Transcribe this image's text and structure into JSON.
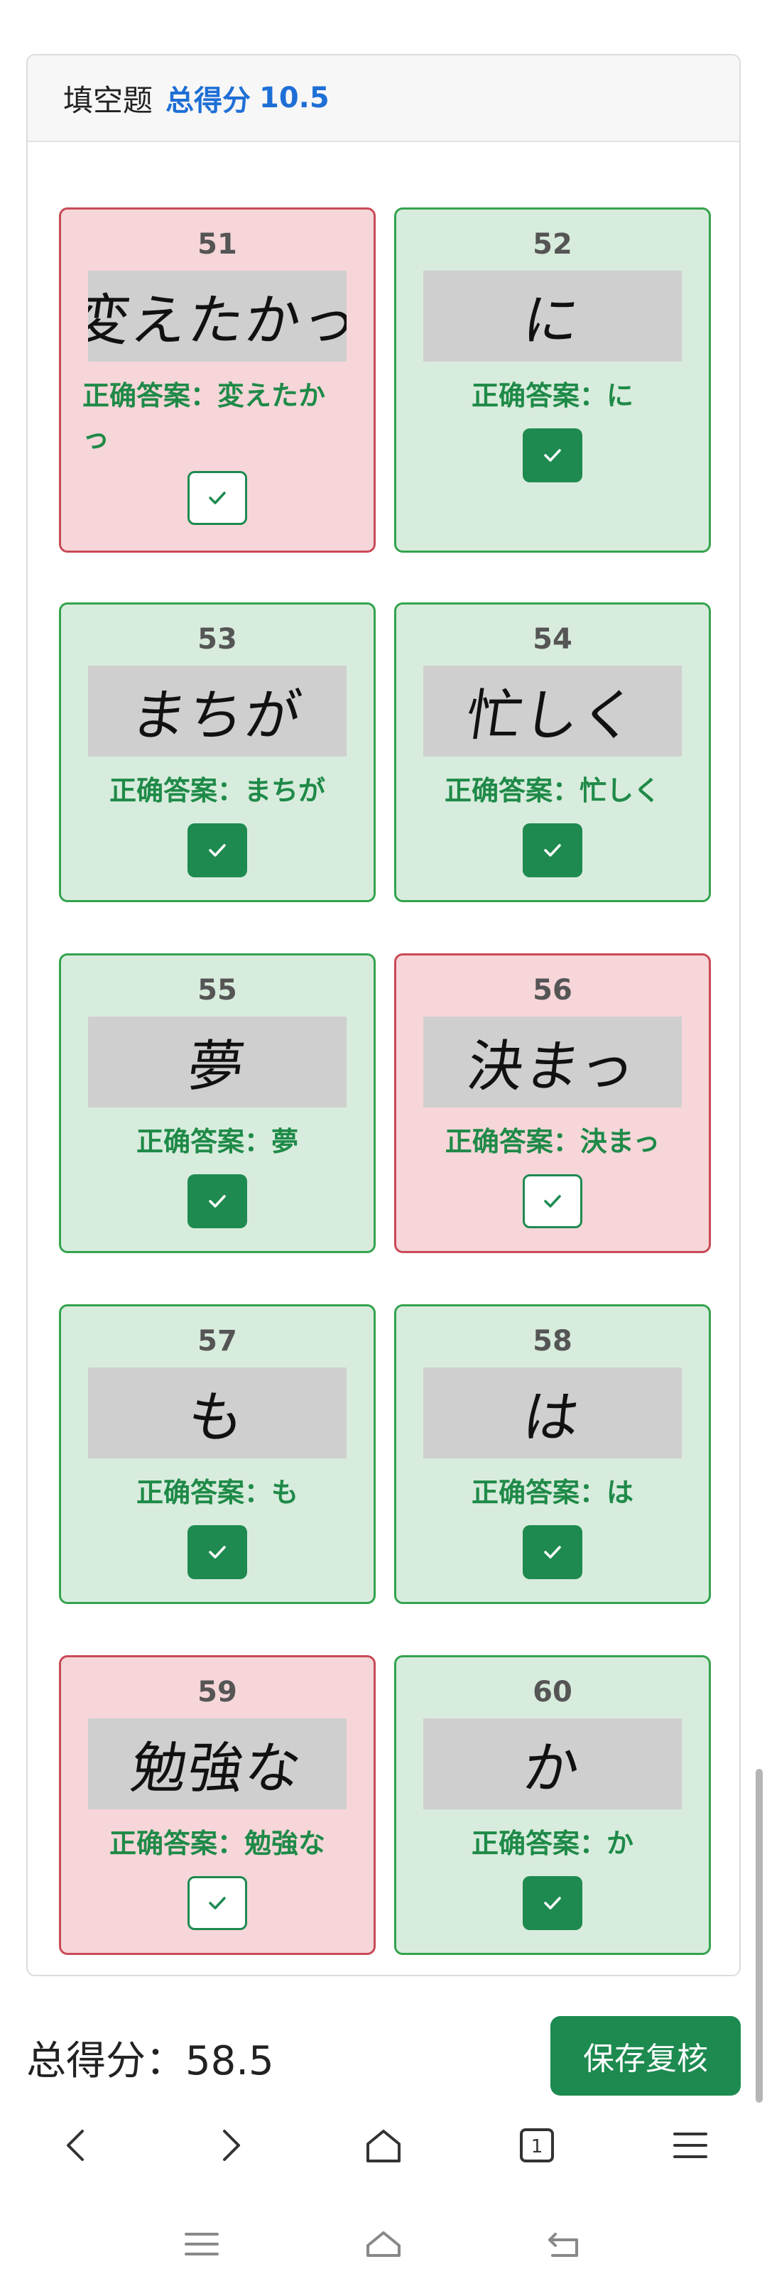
{
  "section": {
    "title": "填空题",
    "score_label": "总得分",
    "score_value": "10.5"
  },
  "items": [
    {
      "num": "51",
      "handwriting": "変えたかっ",
      "correct_label": "正确答案：",
      "correct_answer": "変えたかっ",
      "status": "wrong",
      "checked": false
    },
    {
      "num": "52",
      "handwriting": "に",
      "correct_label": "正确答案：",
      "correct_answer": "に",
      "status": "correct",
      "checked": true
    },
    {
      "num": "53",
      "handwriting": "まちが",
      "correct_label": "正确答案：",
      "correct_answer": "まちが",
      "status": "correct",
      "checked": true
    },
    {
      "num": "54",
      "handwriting": "忙しく",
      "correct_label": "正确答案：",
      "correct_answer": "忙しく",
      "status": "correct",
      "checked": true
    },
    {
      "num": "55",
      "handwriting": "夢",
      "correct_label": "正确答案：",
      "correct_answer": "夢",
      "status": "correct",
      "checked": true
    },
    {
      "num": "56",
      "handwriting": "決まっ",
      "correct_label": "正确答案：",
      "correct_answer": "決まっ",
      "status": "wrong",
      "checked": false
    },
    {
      "num": "57",
      "handwriting": "も",
      "correct_label": "正确答案：",
      "correct_answer": "も",
      "status": "correct",
      "checked": true
    },
    {
      "num": "58",
      "handwriting": "は",
      "correct_label": "正确答案：",
      "correct_answer": "は",
      "status": "correct",
      "checked": true
    },
    {
      "num": "59",
      "handwriting": "勉強な",
      "correct_label": "正确答案：",
      "correct_answer": "勉強な",
      "status": "wrong",
      "checked": false
    },
    {
      "num": "60",
      "handwriting": "か",
      "correct_label": "正确答案：",
      "correct_answer": "か",
      "status": "correct",
      "checked": true
    }
  ],
  "footer": {
    "total_label": "总得分：",
    "total_value": "58.5",
    "save_button": "保存复核"
  },
  "browser_nav": {
    "tab_count": "1",
    "icons": [
      "back-icon",
      "forward-icon",
      "home-icon",
      "tabs-icon",
      "menu-icon"
    ]
  },
  "system_nav": {
    "icons": [
      "recents-icon",
      "home-icon",
      "back-icon"
    ]
  },
  "colors": {
    "correct_bg": "#d8ecdd",
    "correct_border": "#33a34e",
    "wrong_bg": "#f6d6d9",
    "wrong_border": "#c94a55",
    "accent_green": "#1e8a50",
    "accent_blue": "#1e6fd6"
  }
}
